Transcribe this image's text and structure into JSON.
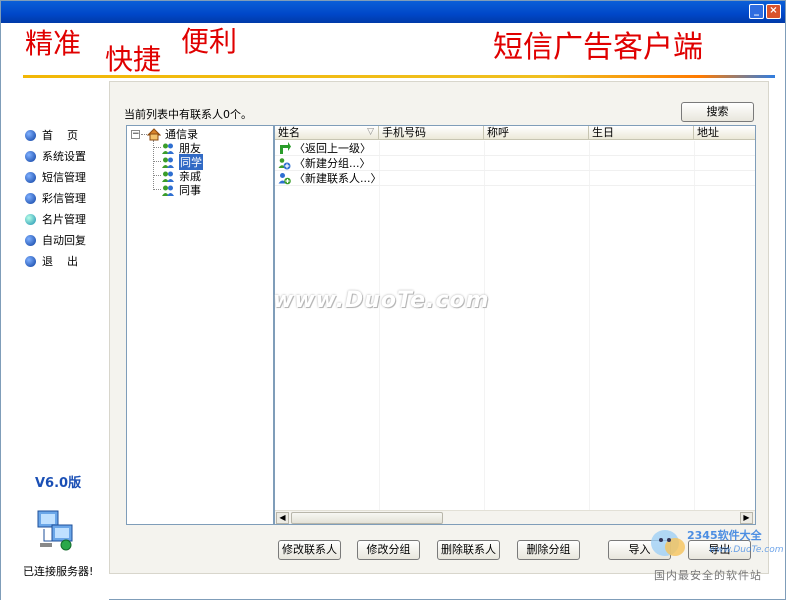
{
  "window": {
    "min_label": "_",
    "close_label": "×"
  },
  "banner": {
    "slogan_1": "精准",
    "slogan_2": "快捷",
    "slogan_3": "便利",
    "brand": "短信广告客户端"
  },
  "nav": {
    "items": [
      {
        "label": "首    页"
      },
      {
        "label": "系统设置"
      },
      {
        "label": "短信管理"
      },
      {
        "label": "彩信管理"
      },
      {
        "label": "名片管理",
        "active": true
      },
      {
        "label": "自动回复"
      },
      {
        "label": "退    出"
      }
    ],
    "version": "V6.0版",
    "server_status": "已连接服务器!"
  },
  "main": {
    "count_text": "当前列表中有联系人0个。",
    "search_label": "搜索",
    "tree": {
      "root": "通信录",
      "groups": [
        {
          "label": "朋友",
          "selected": false
        },
        {
          "label": "同学",
          "selected": true
        },
        {
          "label": "亲戚",
          "selected": false
        },
        {
          "label": "同事",
          "selected": false
        }
      ]
    },
    "list": {
      "columns": [
        "姓名",
        "手机号码",
        "称呼",
        "生日",
        "地址"
      ],
      "rows": [
        "〈返回上一级〉",
        "〈新建分组...〉",
        "〈新建联系人...〉"
      ]
    },
    "actions": {
      "edit_contact": "修改联系人",
      "edit_group": "修改分组",
      "delete_contact": "删除联系人",
      "delete_group": "删除分组",
      "import": "导入",
      "export": "导出"
    }
  },
  "overlays": {
    "watermark": "www.DuoTe.com",
    "corner_logo": "2345软件大全",
    "corner_url": "www.DuoTe.com",
    "corner_text": "国内最安全的软件站"
  },
  "colors": {
    "slogan": "#e00000",
    "title_bar": "#0047c8",
    "selection": "#316ac5",
    "nav_bullet": "#0c3fa0"
  }
}
